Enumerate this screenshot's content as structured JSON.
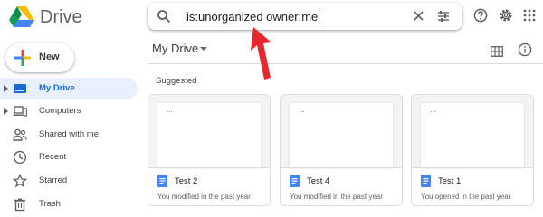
{
  "header": {
    "app_name": "Drive",
    "search": {
      "query": "is:unorganized owner:me"
    }
  },
  "sidebar": {
    "new_label": "New",
    "items": [
      {
        "label": "My Drive",
        "icon": "my-drive-icon",
        "active": true
      },
      {
        "label": "Computers",
        "icon": "computers-icon",
        "active": false
      },
      {
        "label": "Shared with me",
        "icon": "shared-icon",
        "active": false
      },
      {
        "label": "Recent",
        "icon": "clock-icon",
        "active": false
      },
      {
        "label": "Starred",
        "icon": "star-icon",
        "active": false
      },
      {
        "label": "Trash",
        "icon": "trash-icon",
        "active": false
      }
    ]
  },
  "main": {
    "breadcrumb": "My Drive",
    "section_title": "Suggested",
    "files": [
      {
        "title": "Test 2",
        "subtitle": "You modified in the past year"
      },
      {
        "title": "Test 4",
        "subtitle": "You modified in the past year"
      },
      {
        "title": "Test 1",
        "subtitle": "You opened in the past year"
      }
    ]
  },
  "colors": {
    "accent": "#1a73e8",
    "active_nav_bg": "#e8f0fe",
    "annotation_arrow": "#e8262e",
    "doc_icon": "#4285f4"
  }
}
